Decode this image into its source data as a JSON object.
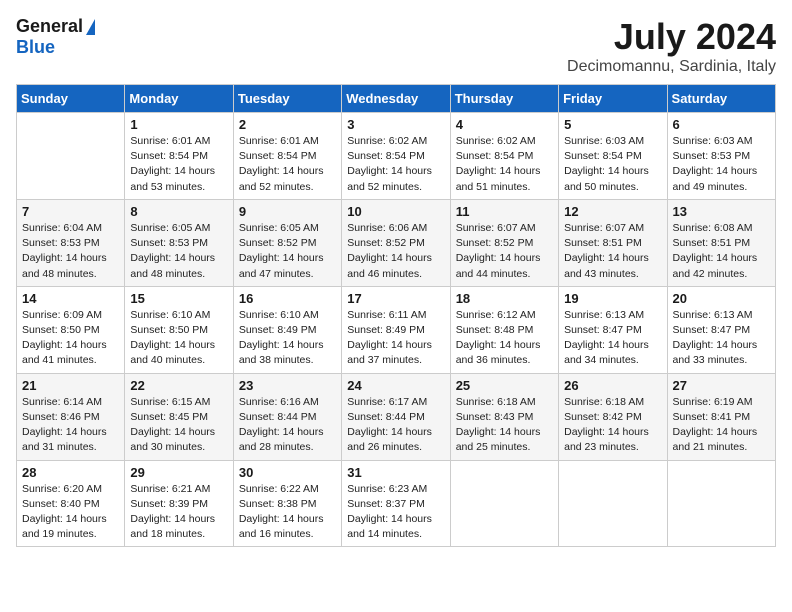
{
  "logo": {
    "general": "General",
    "blue": "Blue"
  },
  "title": "July 2024",
  "location": "Decimomannu, Sardinia, Italy",
  "days_of_week": [
    "Sunday",
    "Monday",
    "Tuesday",
    "Wednesday",
    "Thursday",
    "Friday",
    "Saturday"
  ],
  "weeks": [
    [
      {
        "day": "",
        "content": ""
      },
      {
        "day": "1",
        "content": "Sunrise: 6:01 AM\nSunset: 8:54 PM\nDaylight: 14 hours\nand 53 minutes."
      },
      {
        "day": "2",
        "content": "Sunrise: 6:01 AM\nSunset: 8:54 PM\nDaylight: 14 hours\nand 52 minutes."
      },
      {
        "day": "3",
        "content": "Sunrise: 6:02 AM\nSunset: 8:54 PM\nDaylight: 14 hours\nand 52 minutes."
      },
      {
        "day": "4",
        "content": "Sunrise: 6:02 AM\nSunset: 8:54 PM\nDaylight: 14 hours\nand 51 minutes."
      },
      {
        "day": "5",
        "content": "Sunrise: 6:03 AM\nSunset: 8:54 PM\nDaylight: 14 hours\nand 50 minutes."
      },
      {
        "day": "6",
        "content": "Sunrise: 6:03 AM\nSunset: 8:53 PM\nDaylight: 14 hours\nand 49 minutes."
      }
    ],
    [
      {
        "day": "7",
        "content": "Sunrise: 6:04 AM\nSunset: 8:53 PM\nDaylight: 14 hours\nand 48 minutes."
      },
      {
        "day": "8",
        "content": "Sunrise: 6:05 AM\nSunset: 8:53 PM\nDaylight: 14 hours\nand 48 minutes."
      },
      {
        "day": "9",
        "content": "Sunrise: 6:05 AM\nSunset: 8:52 PM\nDaylight: 14 hours\nand 47 minutes."
      },
      {
        "day": "10",
        "content": "Sunrise: 6:06 AM\nSunset: 8:52 PM\nDaylight: 14 hours\nand 46 minutes."
      },
      {
        "day": "11",
        "content": "Sunrise: 6:07 AM\nSunset: 8:52 PM\nDaylight: 14 hours\nand 44 minutes."
      },
      {
        "day": "12",
        "content": "Sunrise: 6:07 AM\nSunset: 8:51 PM\nDaylight: 14 hours\nand 43 minutes."
      },
      {
        "day": "13",
        "content": "Sunrise: 6:08 AM\nSunset: 8:51 PM\nDaylight: 14 hours\nand 42 minutes."
      }
    ],
    [
      {
        "day": "14",
        "content": "Sunrise: 6:09 AM\nSunset: 8:50 PM\nDaylight: 14 hours\nand 41 minutes."
      },
      {
        "day": "15",
        "content": "Sunrise: 6:10 AM\nSunset: 8:50 PM\nDaylight: 14 hours\nand 40 minutes."
      },
      {
        "day": "16",
        "content": "Sunrise: 6:10 AM\nSunset: 8:49 PM\nDaylight: 14 hours\nand 38 minutes."
      },
      {
        "day": "17",
        "content": "Sunrise: 6:11 AM\nSunset: 8:49 PM\nDaylight: 14 hours\nand 37 minutes."
      },
      {
        "day": "18",
        "content": "Sunrise: 6:12 AM\nSunset: 8:48 PM\nDaylight: 14 hours\nand 36 minutes."
      },
      {
        "day": "19",
        "content": "Sunrise: 6:13 AM\nSunset: 8:47 PM\nDaylight: 14 hours\nand 34 minutes."
      },
      {
        "day": "20",
        "content": "Sunrise: 6:13 AM\nSunset: 8:47 PM\nDaylight: 14 hours\nand 33 minutes."
      }
    ],
    [
      {
        "day": "21",
        "content": "Sunrise: 6:14 AM\nSunset: 8:46 PM\nDaylight: 14 hours\nand 31 minutes."
      },
      {
        "day": "22",
        "content": "Sunrise: 6:15 AM\nSunset: 8:45 PM\nDaylight: 14 hours\nand 30 minutes."
      },
      {
        "day": "23",
        "content": "Sunrise: 6:16 AM\nSunset: 8:44 PM\nDaylight: 14 hours\nand 28 minutes."
      },
      {
        "day": "24",
        "content": "Sunrise: 6:17 AM\nSunset: 8:44 PM\nDaylight: 14 hours\nand 26 minutes."
      },
      {
        "day": "25",
        "content": "Sunrise: 6:18 AM\nSunset: 8:43 PM\nDaylight: 14 hours\nand 25 minutes."
      },
      {
        "day": "26",
        "content": "Sunrise: 6:18 AM\nSunset: 8:42 PM\nDaylight: 14 hours\nand 23 minutes."
      },
      {
        "day": "27",
        "content": "Sunrise: 6:19 AM\nSunset: 8:41 PM\nDaylight: 14 hours\nand 21 minutes."
      }
    ],
    [
      {
        "day": "28",
        "content": "Sunrise: 6:20 AM\nSunset: 8:40 PM\nDaylight: 14 hours\nand 19 minutes."
      },
      {
        "day": "29",
        "content": "Sunrise: 6:21 AM\nSunset: 8:39 PM\nDaylight: 14 hours\nand 18 minutes."
      },
      {
        "day": "30",
        "content": "Sunrise: 6:22 AM\nSunset: 8:38 PM\nDaylight: 14 hours\nand 16 minutes."
      },
      {
        "day": "31",
        "content": "Sunrise: 6:23 AM\nSunset: 8:37 PM\nDaylight: 14 hours\nand 14 minutes."
      },
      {
        "day": "",
        "content": ""
      },
      {
        "day": "",
        "content": ""
      },
      {
        "day": "",
        "content": ""
      }
    ]
  ]
}
